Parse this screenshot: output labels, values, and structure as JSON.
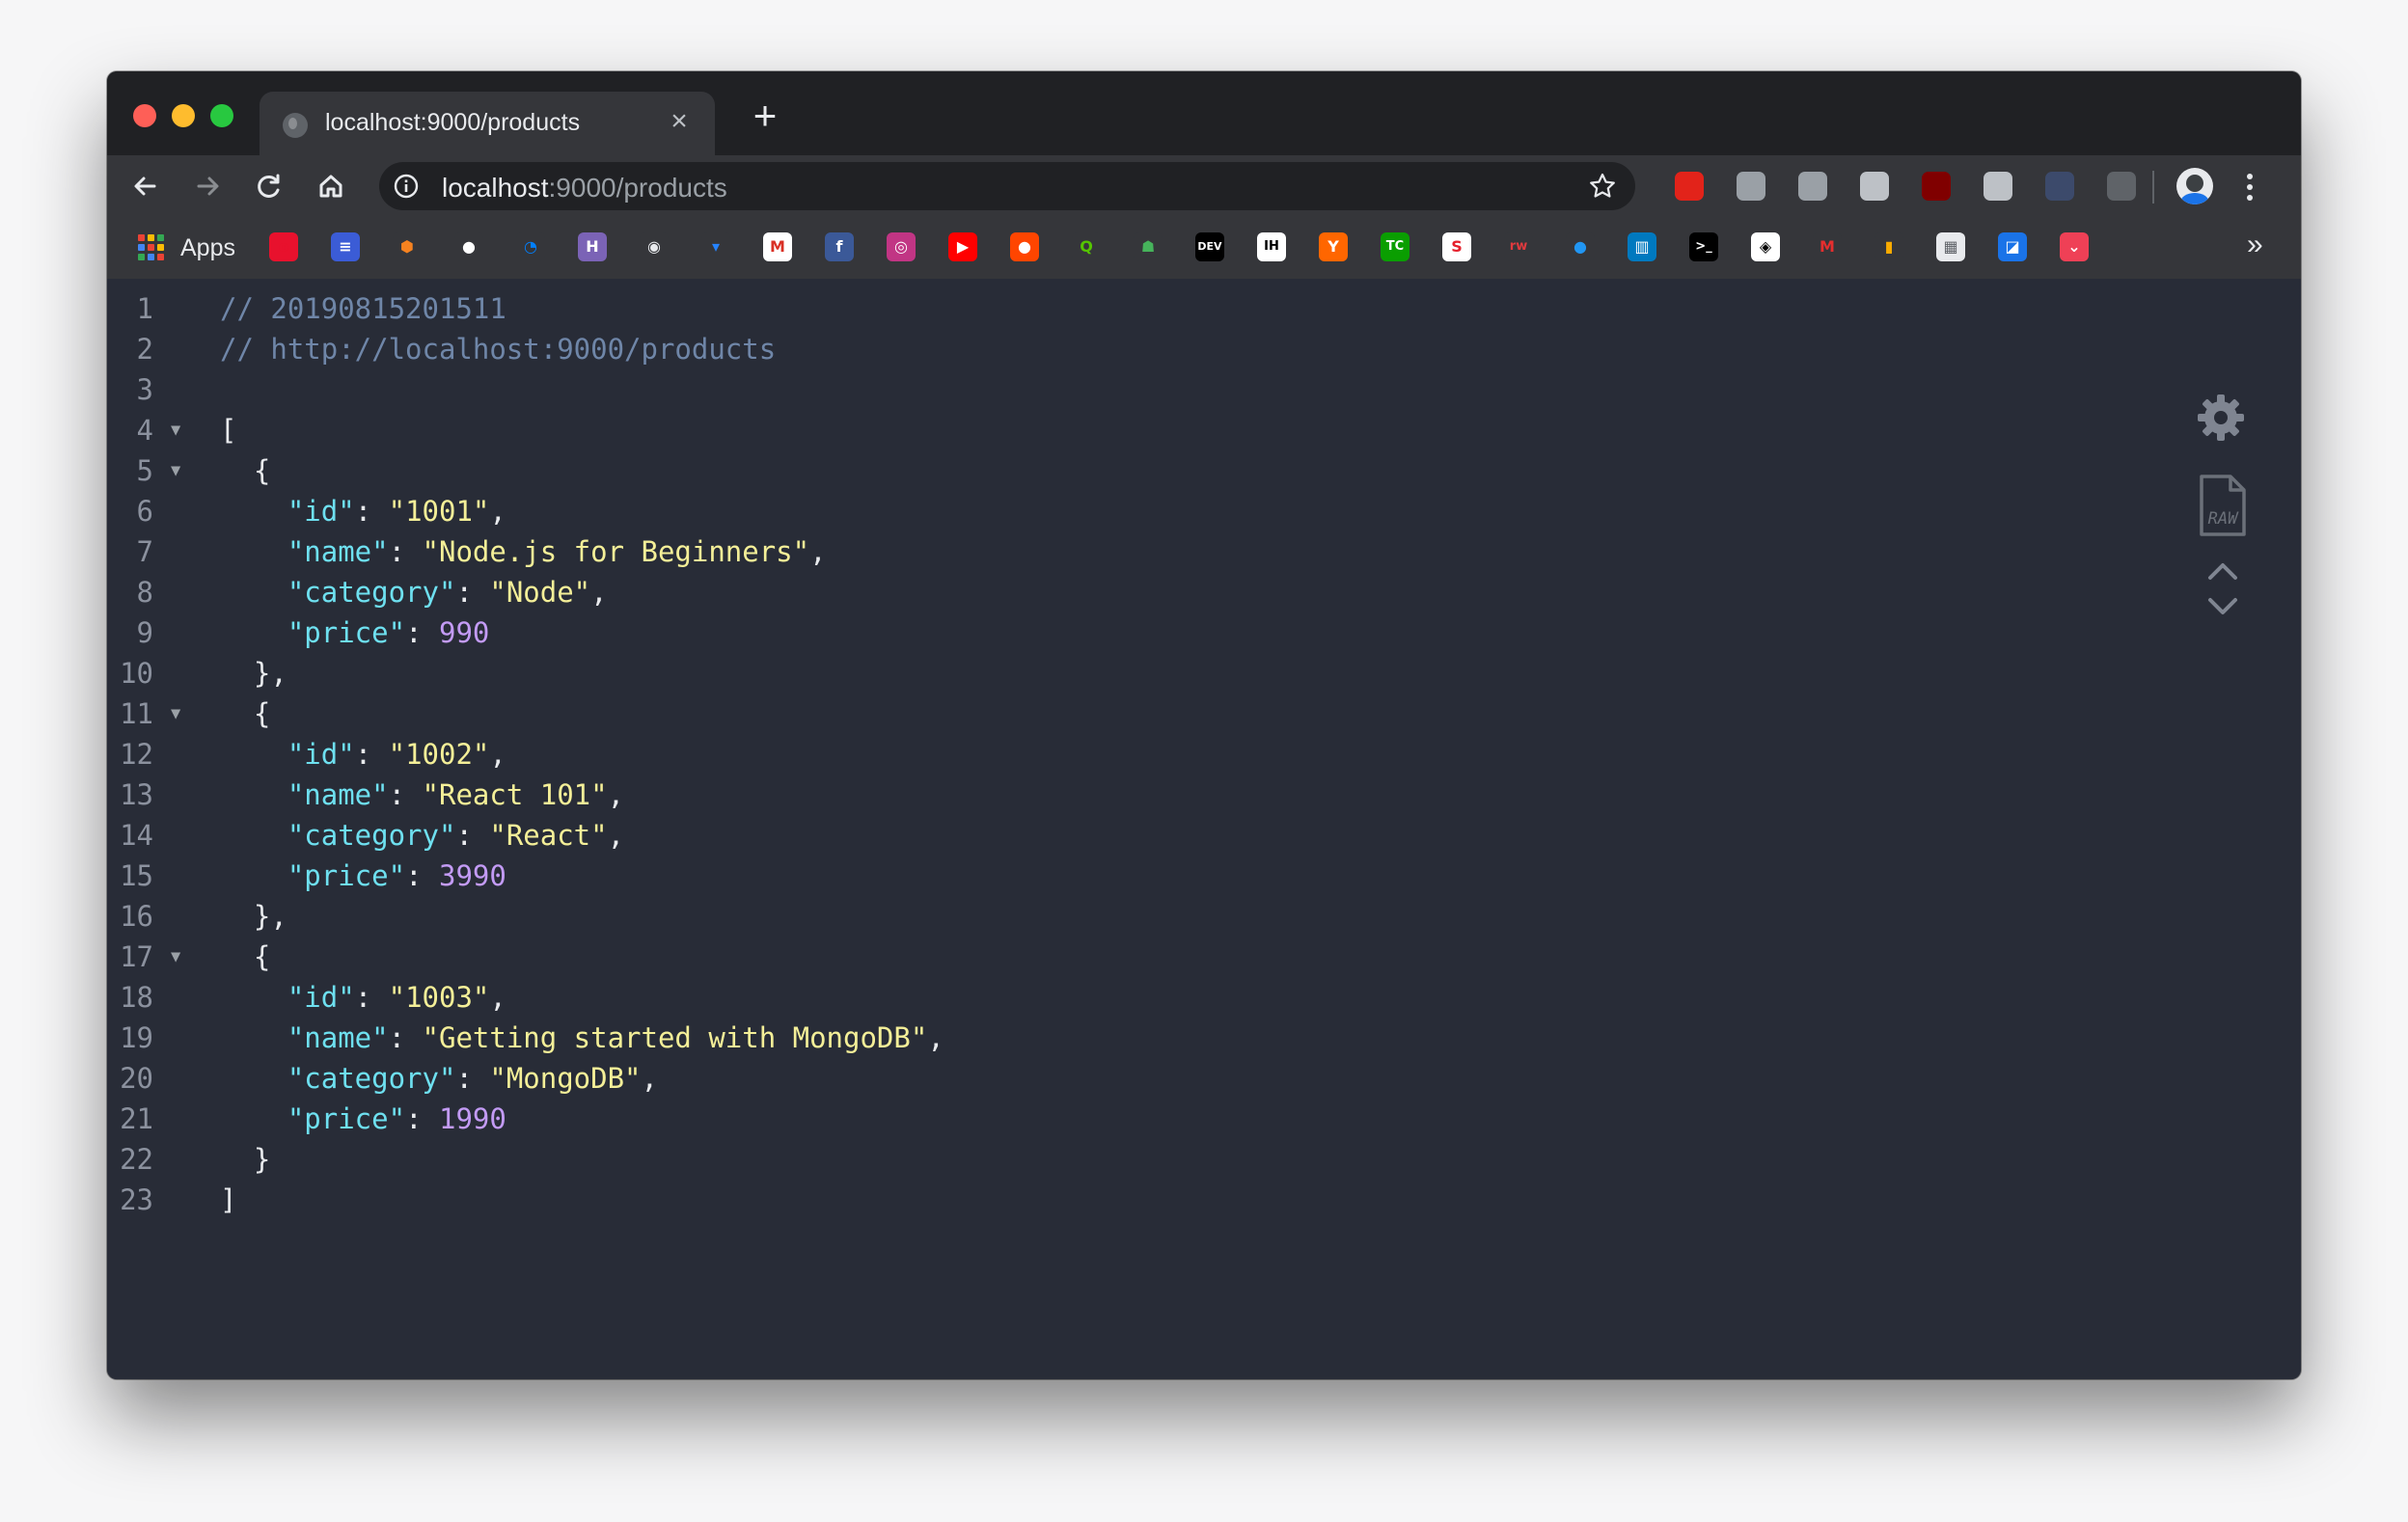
{
  "browser": {
    "tab": {
      "title": "localhost:9000/products",
      "close": "×"
    },
    "new_tab": "+",
    "omnibox": {
      "host": "localhost",
      "path": ":9000/products"
    },
    "colors": {
      "close": "#fe5f57",
      "minimize": "#febc2e",
      "maximize": "#28c840"
    }
  },
  "bookmarks": {
    "apps_label": "Apps",
    "more": "»",
    "items": [
      {
        "name": "opera",
        "glyph": "o",
        "color": "#e8112d",
        "text": "#e8112d"
      },
      {
        "name": "calendar-app",
        "glyph": "≡",
        "color": "#3b5cd6",
        "text": "#ffffff"
      },
      {
        "name": "cube",
        "glyph": "⬢",
        "color": "#35363a",
        "text": "#f58220"
      },
      {
        "name": "panda",
        "glyph": "●",
        "color": "#35363a",
        "text": "#ffffff"
      },
      {
        "name": "digitalocean",
        "glyph": "◔",
        "color": "#35363a",
        "text": "#0080ff"
      },
      {
        "name": "heroku",
        "glyph": "H",
        "color": "#7b63b6",
        "text": "#ffffff"
      },
      {
        "name": "github",
        "glyph": "◉",
        "color": "#35363a",
        "text": "#e8eaed"
      },
      {
        "name": "bitbucket",
        "glyph": "▾",
        "color": "#35363a",
        "text": "#2684ff"
      },
      {
        "name": "gmail",
        "glyph": "M",
        "color": "#ffffff",
        "text": "#d93025"
      },
      {
        "name": "facebook",
        "glyph": "f",
        "color": "#3b5998",
        "text": "#ffffff"
      },
      {
        "name": "instagram",
        "glyph": "◎",
        "color": "#c13584",
        "text": "#ffffff"
      },
      {
        "name": "youtube",
        "glyph": "▶",
        "color": "#ff0000",
        "text": "#ffffff"
      },
      {
        "name": "reddit",
        "glyph": "●",
        "color": "#ff4500",
        "text": "#ffffff"
      },
      {
        "name": "qiita",
        "glyph": "Q",
        "color": "#35363a",
        "text": "#55c500"
      },
      {
        "name": "alien",
        "glyph": "☗",
        "color": "#35363a",
        "text": "#46b35b"
      },
      {
        "name": "dev",
        "glyph": "DEV",
        "color": "#000000",
        "text": "#ffffff"
      },
      {
        "name": "indiehackers",
        "glyph": "IH",
        "color": "#ffffff",
        "text": "#000000"
      },
      {
        "name": "hackernews",
        "glyph": "Y",
        "color": "#ff6600",
        "text": "#ffffff"
      },
      {
        "name": "techcrunch",
        "glyph": "TC",
        "color": "#0a9e01",
        "text": "#ffffff"
      },
      {
        "name": "scrimba",
        "glyph": "S",
        "color": "#ffffff",
        "text": "#e5202c"
      },
      {
        "name": "raywenderlich",
        "glyph": "rw",
        "color": "#35363a",
        "text": "#e03a3e"
      },
      {
        "name": "drop",
        "glyph": "●",
        "color": "#35363a",
        "text": "#2196f3"
      },
      {
        "name": "trello",
        "glyph": "▥",
        "color": "#0079bf",
        "text": "#ffffff"
      },
      {
        "name": "terminal",
        "glyph": ">_",
        "color": "#000000",
        "text": "#ffffff"
      },
      {
        "name": "codepen",
        "glyph": "◈",
        "color": "#ffffff",
        "text": "#000000"
      },
      {
        "name": "medium",
        "glyph": "M",
        "color": "#35363a",
        "text": "#e52e2e"
      },
      {
        "name": "analytics",
        "glyph": "▮",
        "color": "#35363a",
        "text": "#f9ab00"
      },
      {
        "name": "calendar",
        "glyph": "▦",
        "color": "#e8eaed",
        "text": "#5f6368"
      },
      {
        "name": "docs",
        "glyph": "◪",
        "color": "#1a73e8",
        "text": "#ffffff"
      },
      {
        "name": "pocket",
        "glyph": "⌄",
        "color": "#ef4056",
        "text": "#ffffff"
      }
    ]
  },
  "extensions": [
    {
      "name": "adblock-icon",
      "color": "#e2231a"
    },
    {
      "name": "target-icon",
      "color": "#9aa0a6"
    },
    {
      "name": "vue-devtools-icon",
      "color": "#9aa0a6"
    },
    {
      "name": "react-devtools-icon",
      "color": "#bdc1c6"
    },
    {
      "name": "ublock-icon",
      "color": "#800000"
    },
    {
      "name": "extension-puzzle-icon",
      "color": "#bdc1c6"
    },
    {
      "name": "angular-icon",
      "color": "#3c4a6b"
    },
    {
      "name": "json-formatter-icon",
      "color": "#5f6368"
    }
  ],
  "json_viewer": {
    "lines": [
      {
        "n": "1",
        "fold": "",
        "tokens": [
          {
            "c": "cm",
            "t": "// 20190815201511"
          }
        ]
      },
      {
        "n": "2",
        "fold": "",
        "tokens": [
          {
            "c": "cm",
            "t": "// http://localhost:9000/products"
          }
        ]
      },
      {
        "n": "3",
        "fold": "",
        "tokens": []
      },
      {
        "n": "4",
        "fold": "▼",
        "tokens": [
          {
            "c": "pun",
            "t": "["
          }
        ]
      },
      {
        "n": "5",
        "fold": "▼",
        "tokens": [
          {
            "c": "pun",
            "t": "  {"
          }
        ]
      },
      {
        "n": "6",
        "fold": "",
        "tokens": [
          {
            "c": "pun",
            "t": "    "
          },
          {
            "c": "key",
            "t": "\"id\""
          },
          {
            "c": "pun",
            "t": ": "
          },
          {
            "c": "str",
            "t": "\"1001\""
          },
          {
            "c": "pun",
            "t": ","
          }
        ]
      },
      {
        "n": "7",
        "fold": "",
        "tokens": [
          {
            "c": "pun",
            "t": "    "
          },
          {
            "c": "key",
            "t": "\"name\""
          },
          {
            "c": "pun",
            "t": ": "
          },
          {
            "c": "str",
            "t": "\"Node.js for Beginners\""
          },
          {
            "c": "pun",
            "t": ","
          }
        ]
      },
      {
        "n": "8",
        "fold": "",
        "tokens": [
          {
            "c": "pun",
            "t": "    "
          },
          {
            "c": "key",
            "t": "\"category\""
          },
          {
            "c": "pun",
            "t": ": "
          },
          {
            "c": "str",
            "t": "\"Node\""
          },
          {
            "c": "pun",
            "t": ","
          }
        ]
      },
      {
        "n": "9",
        "fold": "",
        "tokens": [
          {
            "c": "pun",
            "t": "    "
          },
          {
            "c": "key",
            "t": "\"price\""
          },
          {
            "c": "pun",
            "t": ": "
          },
          {
            "c": "num",
            "t": "990"
          }
        ]
      },
      {
        "n": "10",
        "fold": "",
        "tokens": [
          {
            "c": "pun",
            "t": "  },"
          }
        ]
      },
      {
        "n": "11",
        "fold": "▼",
        "tokens": [
          {
            "c": "pun",
            "t": "  {"
          }
        ]
      },
      {
        "n": "12",
        "fold": "",
        "tokens": [
          {
            "c": "pun",
            "t": "    "
          },
          {
            "c": "key",
            "t": "\"id\""
          },
          {
            "c": "pun",
            "t": ": "
          },
          {
            "c": "str",
            "t": "\"1002\""
          },
          {
            "c": "pun",
            "t": ","
          }
        ]
      },
      {
        "n": "13",
        "fold": "",
        "tokens": [
          {
            "c": "pun",
            "t": "    "
          },
          {
            "c": "key",
            "t": "\"name\""
          },
          {
            "c": "pun",
            "t": ": "
          },
          {
            "c": "str",
            "t": "\"React 101\""
          },
          {
            "c": "pun",
            "t": ","
          }
        ]
      },
      {
        "n": "14",
        "fold": "",
        "tokens": [
          {
            "c": "pun",
            "t": "    "
          },
          {
            "c": "key",
            "t": "\"category\""
          },
          {
            "c": "pun",
            "t": ": "
          },
          {
            "c": "str",
            "t": "\"React\""
          },
          {
            "c": "pun",
            "t": ","
          }
        ]
      },
      {
        "n": "15",
        "fold": "",
        "tokens": [
          {
            "c": "pun",
            "t": "    "
          },
          {
            "c": "key",
            "t": "\"price\""
          },
          {
            "c": "pun",
            "t": ": "
          },
          {
            "c": "num",
            "t": "3990"
          }
        ]
      },
      {
        "n": "16",
        "fold": "",
        "tokens": [
          {
            "c": "pun",
            "t": "  },"
          }
        ]
      },
      {
        "n": "17",
        "fold": "▼",
        "tokens": [
          {
            "c": "pun",
            "t": "  {"
          }
        ]
      },
      {
        "n": "18",
        "fold": "",
        "tokens": [
          {
            "c": "pun",
            "t": "    "
          },
          {
            "c": "key",
            "t": "\"id\""
          },
          {
            "c": "pun",
            "t": ": "
          },
          {
            "c": "str",
            "t": "\"1003\""
          },
          {
            "c": "pun",
            "t": ","
          }
        ]
      },
      {
        "n": "19",
        "fold": "",
        "tokens": [
          {
            "c": "pun",
            "t": "    "
          },
          {
            "c": "key",
            "t": "\"name\""
          },
          {
            "c": "pun",
            "t": ": "
          },
          {
            "c": "str",
            "t": "\"Getting started with MongoDB\""
          },
          {
            "c": "pun",
            "t": ","
          }
        ]
      },
      {
        "n": "20",
        "fold": "",
        "tokens": [
          {
            "c": "pun",
            "t": "    "
          },
          {
            "c": "key",
            "t": "\"category\""
          },
          {
            "c": "pun",
            "t": ": "
          },
          {
            "c": "str",
            "t": "\"MongoDB\""
          },
          {
            "c": "pun",
            "t": ","
          }
        ]
      },
      {
        "n": "21",
        "fold": "",
        "tokens": [
          {
            "c": "pun",
            "t": "    "
          },
          {
            "c": "key",
            "t": "\"price\""
          },
          {
            "c": "pun",
            "t": ": "
          },
          {
            "c": "num",
            "t": "1990"
          }
        ]
      },
      {
        "n": "22",
        "fold": "",
        "tokens": [
          {
            "c": "pun",
            "t": "  }"
          }
        ]
      },
      {
        "n": "23",
        "fold": "",
        "tokens": [
          {
            "c": "pun",
            "t": "]"
          }
        ]
      }
    ],
    "side_tools": {
      "raw_label": "RAW"
    }
  }
}
